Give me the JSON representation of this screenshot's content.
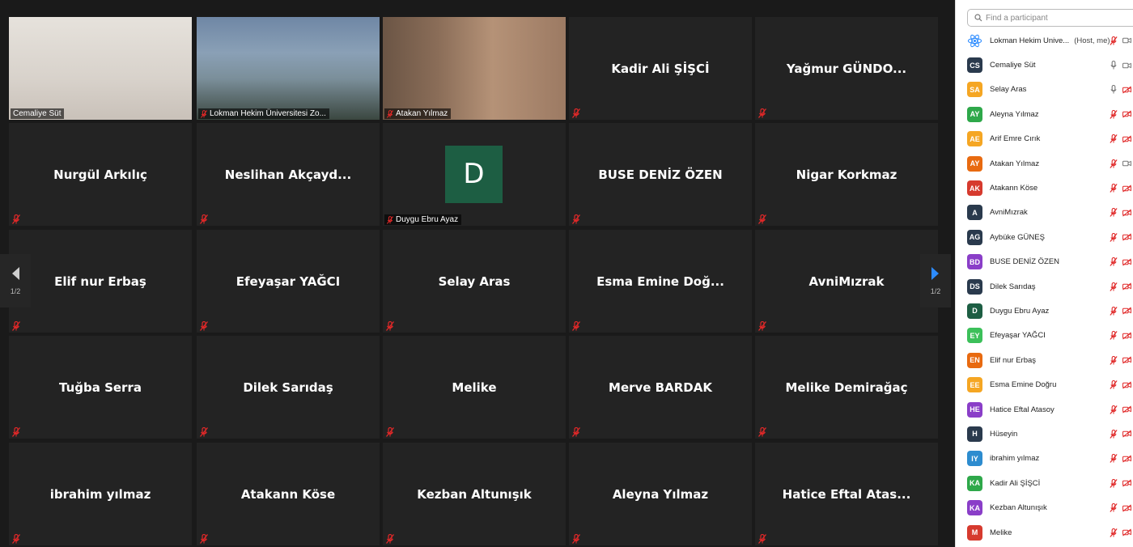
{
  "search": {
    "placeholder": "Find a participant"
  },
  "nav": {
    "page_left": "1/2",
    "page_right": "1/2"
  },
  "colors": {
    "active_speaker": "#e8e85a",
    "muted_red": "#e02828",
    "arrow_blue": "#2d8cff"
  },
  "tiles": [
    {
      "name": "Cemaliye Süt",
      "kind": "video-self",
      "label": "Cemaliye Süt",
      "active": true
    },
    {
      "name": "Lokman Hekim Üniversitesi Zo...",
      "kind": "video-building",
      "label": "Lokman Hekim Üniversitesi Zo...",
      "muted": true
    },
    {
      "name": "Atakan Yılmaz",
      "kind": "video-man",
      "label": "Atakan Yılmaz",
      "muted": true
    },
    {
      "name": "Kadir Ali ŞİŞCİ"
    },
    {
      "name": "Yağmur GÜNDO..."
    },
    {
      "name": "Nurgül Arkılıç"
    },
    {
      "name": "Neslihan Akçayd..."
    },
    {
      "name": "Duygu Ebru Ayaz",
      "kind": "avatar",
      "initial": "D",
      "label": "Duygu Ebru Ayaz",
      "muted": true
    },
    {
      "name": "BUSE DENİZ ÖZEN"
    },
    {
      "name": "Nigar Korkmaz"
    },
    {
      "name": "Elif nur Erbaş"
    },
    {
      "name": "Efeyaşar YAĞCI"
    },
    {
      "name": "Selay Aras"
    },
    {
      "name": "Esma Emine Doğ..."
    },
    {
      "name": "AvniMızrak"
    },
    {
      "name": "Tuğba Serra"
    },
    {
      "name": "Dilek Sarıdaş"
    },
    {
      "name": "Melike"
    },
    {
      "name": "Merve BARDAK"
    },
    {
      "name": "Melike Demirağaç"
    },
    {
      "name": "ibrahim yılmaz"
    },
    {
      "name": "Atakann Köse"
    },
    {
      "name": "Kezban Altunışık"
    },
    {
      "name": "Aleyna Yılmaz"
    },
    {
      "name": "Hatice Eftal Atas..."
    }
  ],
  "participants": [
    {
      "initials": "",
      "name": "Lokman Hekim Unive...",
      "extra": "(Host, me)",
      "color": "#2d8cff",
      "logo": true,
      "mic": "muted",
      "cam": "on"
    },
    {
      "initials": "CS",
      "name": "Cemaliye Süt",
      "color": "#2a3a4d",
      "mic": "on",
      "cam": "on"
    },
    {
      "initials": "SA",
      "name": "Selay Aras",
      "color": "#f5a623",
      "mic": "on",
      "cam": "off"
    },
    {
      "initials": "AY",
      "name": "Aleyna Yılmaz",
      "color": "#2ea84a",
      "mic": "muted",
      "cam": "off"
    },
    {
      "initials": "AE",
      "name": "Arif Emre Cırık",
      "color": "#f5a623",
      "mic": "muted",
      "cam": "off"
    },
    {
      "initials": "AY",
      "name": "Atakan Yılmaz",
      "color": "#e86a10",
      "mic": "muted",
      "cam": "on"
    },
    {
      "initials": "AK",
      "name": "Atakann Köse",
      "color": "#d63a2e",
      "mic": "muted",
      "cam": "off"
    },
    {
      "initials": "A",
      "name": "AvniMızrak",
      "color": "#2a3a4d",
      "mic": "muted",
      "cam": "off"
    },
    {
      "initials": "AG",
      "name": "Aybüke GÜNEŞ",
      "color": "#2a3a4d",
      "mic": "muted",
      "cam": "off"
    },
    {
      "initials": "BD",
      "name": "BUSE DENİZ ÖZEN",
      "color": "#8a3ec8",
      "mic": "muted",
      "cam": "off"
    },
    {
      "initials": "DS",
      "name": "Dilek Sarıdaş",
      "color": "#2a3a4d",
      "mic": "muted",
      "cam": "off"
    },
    {
      "initials": "D",
      "name": "Duygu Ebru Ayaz",
      "color": "#1d5e43",
      "mic": "muted",
      "cam": "off"
    },
    {
      "initials": "EY",
      "name": "Efeyaşar YAĞCI",
      "color": "#3cc05a",
      "mic": "muted",
      "cam": "off"
    },
    {
      "initials": "EN",
      "name": "Elif nur Erbaş",
      "color": "#e86a10",
      "mic": "muted",
      "cam": "off"
    },
    {
      "initials": "EE",
      "name": "Esma Emine Doğru",
      "color": "#f5a623",
      "mic": "muted",
      "cam": "off"
    },
    {
      "initials": "HE",
      "name": "Hatice Eftal Atasoy",
      "color": "#8a3ec8",
      "mic": "muted",
      "cam": "off"
    },
    {
      "initials": "H",
      "name": "Hüseyin",
      "color": "#2a3a4d",
      "mic": "muted",
      "cam": "off"
    },
    {
      "initials": "IY",
      "name": "ibrahim yılmaz",
      "color": "#2d8ccf",
      "mic": "muted",
      "cam": "off"
    },
    {
      "initials": "KA",
      "name": "Kadir Ali ŞİŞCİ",
      "color": "#2ea84a",
      "mic": "muted",
      "cam": "off"
    },
    {
      "initials": "KA",
      "name": "Kezban Altunışık",
      "color": "#8a3ec8",
      "mic": "muted",
      "cam": "off"
    },
    {
      "initials": "M",
      "name": "Melike",
      "color": "#d63a2e",
      "mic": "muted",
      "cam": "off"
    }
  ]
}
